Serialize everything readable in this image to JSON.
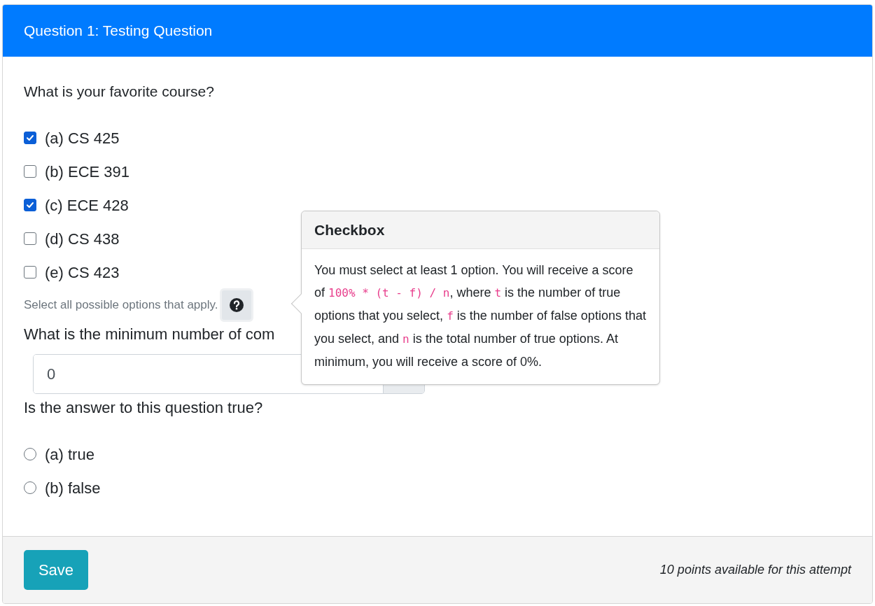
{
  "header": {
    "title": "Question 1: Testing Question"
  },
  "question_1": {
    "prompt": "What is your favorite course?",
    "options": [
      {
        "label": "(a) CS 425",
        "checked": true
      },
      {
        "label": "(b) ECE 391",
        "checked": false
      },
      {
        "label": "(c) ECE 428",
        "checked": true
      },
      {
        "label": "(d) CS 438",
        "checked": false
      },
      {
        "label": "(e) CS 423",
        "checked": false
      }
    ],
    "hint": "Select all possible options that apply."
  },
  "question_2": {
    "prompt": "What is the minimum number of com",
    "value": "0"
  },
  "question_3": {
    "prompt": "Is the answer to this question true?",
    "options": [
      {
        "label": "(a) true",
        "selected": false
      },
      {
        "label": "(b) false",
        "selected": false
      }
    ]
  },
  "popover": {
    "title": "Checkbox",
    "body": [
      {
        "kind": "text",
        "text": "You must select at least 1 option. You will receive a score of "
      },
      {
        "kind": "code",
        "text": "100% * (t - f) / n"
      },
      {
        "kind": "text",
        "text": ", where "
      },
      {
        "kind": "code",
        "text": "t"
      },
      {
        "kind": "text",
        "text": " is the number of true options that you select, "
      },
      {
        "kind": "code",
        "text": "f"
      },
      {
        "kind": "text",
        "text": " is the number of false options that you select, and "
      },
      {
        "kind": "code",
        "text": "n"
      },
      {
        "kind": "text",
        "text": " is the total number of true options. At minimum, you will receive a score of 0%."
      }
    ]
  },
  "footer": {
    "button": "Save",
    "note": "10 points available for this attempt"
  }
}
